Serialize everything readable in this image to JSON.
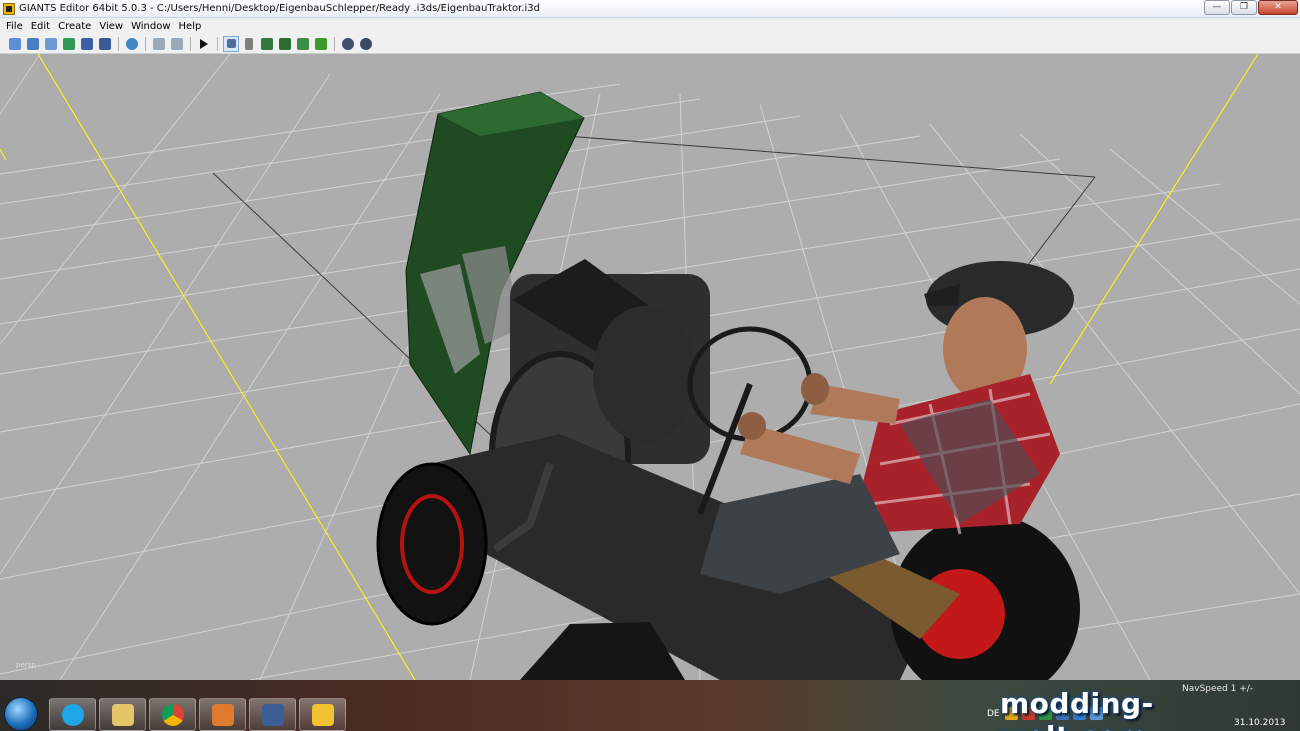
{
  "window": {
    "title": "GIANTS Editor 64bit 5.0.3 - C:/Users/Henni/Desktop/EigenbauSchlepper/Ready .i3ds/EigenbauTraktor.i3d",
    "minimize_glyph": "—",
    "maximize_glyph": "❐",
    "close_glyph": "✕"
  },
  "menu": [
    "File",
    "Edit",
    "Create",
    "View",
    "Window",
    "Help"
  ],
  "toolbar": {
    "icons": [
      "new-scene-icon",
      "open-icon",
      "import-icon",
      "export-icon",
      "save-icon",
      "save-all-icon",
      "refresh-icon",
      "undo-icon",
      "redo-icon",
      "play-icon",
      "select-mode-icon",
      "magnet-icon",
      "terrain-sculpt-icon",
      "terrain-paint-icon",
      "foliage-paint-icon",
      "plant-icon",
      "collision-icon",
      "settings-icon"
    ]
  },
  "viewport": {
    "camera_label": "persp",
    "background_color": "#adadad",
    "grid_color": "#d2d2d2",
    "axis_color": "#ffff00"
  },
  "taskbar": {
    "nav_speed": "NavSpeed 1 +/-",
    "language": "DE",
    "date": "31.10.2013",
    "watermark": "modding-welt.com",
    "apps": [
      "skype-icon",
      "file-explorer-icon",
      "chrome-icon",
      "media-player-icon",
      "giants-editor-icon",
      "notes-icon"
    ]
  }
}
